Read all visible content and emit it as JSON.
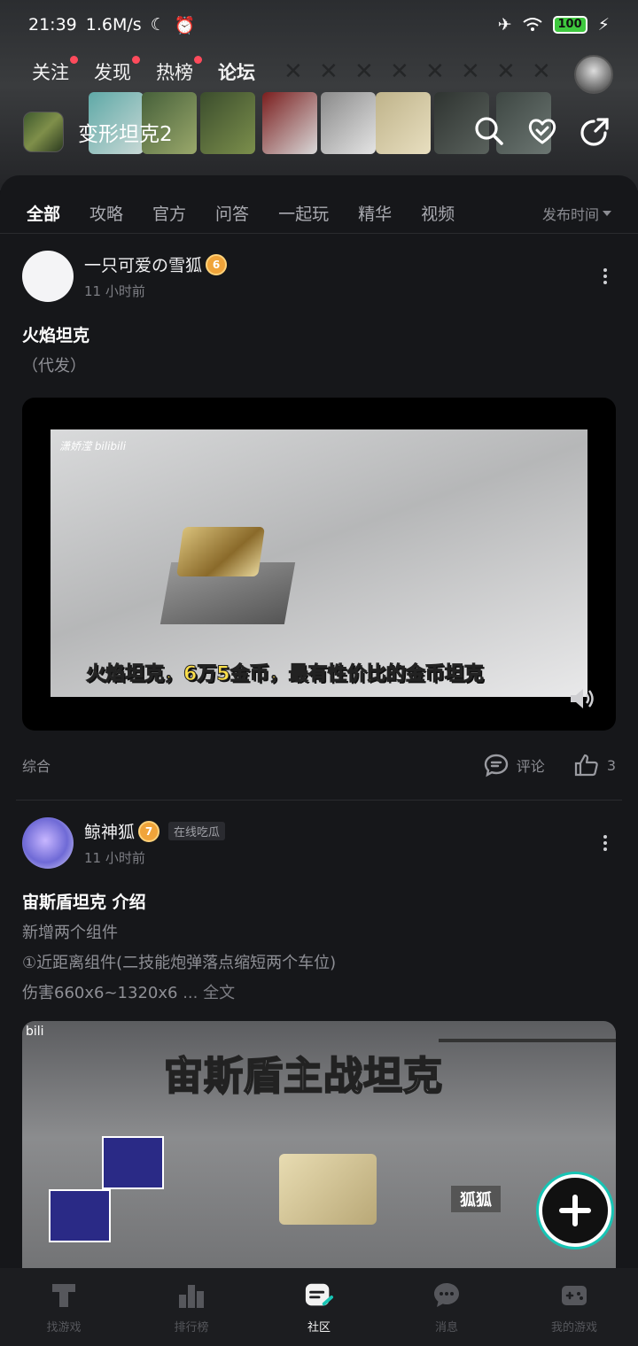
{
  "status_bar": {
    "time": "21:39",
    "speed": "1.6M/s",
    "battery": "100"
  },
  "top_tabs": [
    {
      "label": "关注",
      "dot": true
    },
    {
      "label": "发现",
      "dot": true
    },
    {
      "label": "热榜",
      "dot": true
    },
    {
      "label": "论坛",
      "dot": false,
      "active": true
    }
  ],
  "game": {
    "title": "变形坦克2"
  },
  "sub_tabs": [
    "全部",
    "攻略",
    "官方",
    "问答",
    "一起玩",
    "精华",
    "视频"
  ],
  "sort_label": "发布时间",
  "posts": [
    {
      "author": "一只可爱の雪狐",
      "level": "6",
      "time": "11 小时前",
      "title": "火焰坦克",
      "body": "（代发）",
      "video_caption": "火焰坦克，6万5金币，最有性价比的金币坦克",
      "video_logo": "潇娇滢 bilibili",
      "category": "综合",
      "comment_label": "评论",
      "likes": "3"
    },
    {
      "author": "鲸神狐",
      "level": "7",
      "tag": "在线吃瓜",
      "time": "11 小时前",
      "title": "宙斯盾坦克 介绍",
      "body_lines": [
        "新增两个组件",
        "①近距离组件(二技能炮弹落点缩短两个车位)",
        "伤害660x6~1320x6"
      ],
      "ellipsis": " ... ",
      "readmore": "全文",
      "video_title": "宙斯盾主战坦克",
      "video_label": "狐狐",
      "video_logo": "bili"
    }
  ],
  "bottom_nav": [
    {
      "label": "找游戏",
      "icon": "find-games-icon"
    },
    {
      "label": "排行榜",
      "icon": "ranking-icon"
    },
    {
      "label": "社区",
      "icon": "community-icon",
      "active": true
    },
    {
      "label": "消息",
      "icon": "message-icon"
    },
    {
      "label": "我的游戏",
      "icon": "my-games-icon"
    }
  ],
  "colors": {
    "accent": "#17c4b4",
    "background": "#16171a",
    "dot": "#ff4b5c"
  }
}
